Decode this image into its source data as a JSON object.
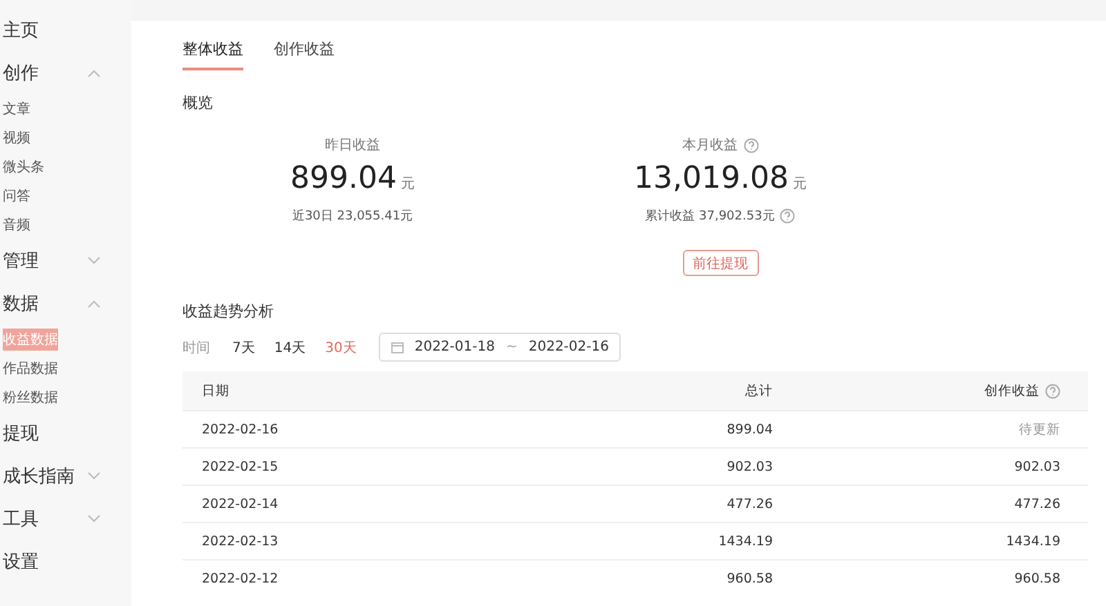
{
  "sidebar": {
    "items": [
      {
        "label": "主页"
      },
      {
        "label": "创作",
        "expanded": true,
        "children": [
          {
            "label": "文章",
            "selected": false
          },
          {
            "label": "视频",
            "selected": false
          },
          {
            "label": "微头条",
            "selected": false
          },
          {
            "label": "问答",
            "selected": false
          },
          {
            "label": "音频",
            "selected": false
          }
        ]
      },
      {
        "label": "管理",
        "expanded": false
      },
      {
        "label": "数据",
        "expanded": true,
        "children": [
          {
            "label": "收益数据",
            "selected": true
          },
          {
            "label": "作品数据",
            "selected": false
          },
          {
            "label": "粉丝数据",
            "selected": false
          }
        ]
      },
      {
        "label": "提现"
      },
      {
        "label": "成长指南",
        "expanded": false
      },
      {
        "label": "工具",
        "expanded": false
      },
      {
        "label": "设置"
      }
    ]
  },
  "tabs": [
    {
      "label": "整体收益",
      "selected": true
    },
    {
      "label": "创作收益",
      "selected": false
    }
  ],
  "overview": {
    "title": "概览",
    "stats": [
      {
        "label": "昨日收益",
        "info": false,
        "value": "899.04",
        "unit": "元",
        "sub": "近30日 23,055.41元",
        "sub_info": false
      },
      {
        "label": "本月收益",
        "info": true,
        "value": "13,019.08",
        "unit": "元",
        "sub": "累计收益 37,902.53元",
        "sub_info": true,
        "button": "前往提现"
      }
    ]
  },
  "trend": {
    "title": "收益趋势分析",
    "range_label": "时间",
    "ranges": [
      {
        "label": "7天",
        "selected": false
      },
      {
        "label": "14天",
        "selected": false
      },
      {
        "label": "30天",
        "selected": true
      }
    ],
    "date_from": "2022-01-18",
    "date_sep": "~",
    "date_to": "2022-02-16"
  },
  "table": {
    "columns": [
      {
        "label": "日期",
        "info": false
      },
      {
        "label": "总计",
        "info": false
      },
      {
        "label": "创作收益",
        "info": true
      }
    ],
    "rows": [
      {
        "cells": [
          "2022-02-16",
          "899.04",
          "待更新"
        ],
        "pending": true
      },
      {
        "cells": [
          "2022-02-15",
          "902.03",
          "902.03"
        ],
        "pending": false
      },
      {
        "cells": [
          "2022-02-14",
          "477.26",
          "477.26"
        ],
        "pending": false
      },
      {
        "cells": [
          "2022-02-13",
          "1434.19",
          "1434.19"
        ],
        "pending": false
      },
      {
        "cells": [
          "2022-02-12",
          "960.58",
          "960.58"
        ],
        "pending": false
      }
    ]
  }
}
